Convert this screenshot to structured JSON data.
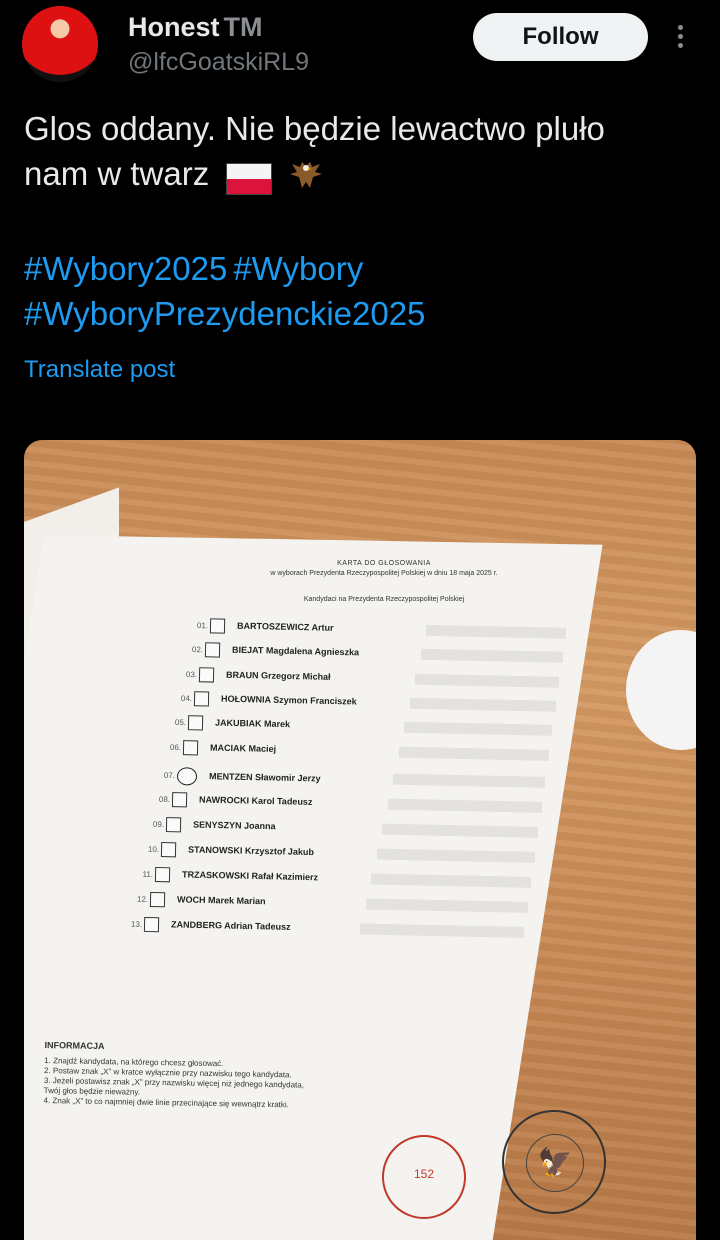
{
  "author": {
    "name": "Honest",
    "badge": "TM",
    "handle": "@lfcGoatskiRL9"
  },
  "follow_label": "Follow",
  "post": {
    "text_line1": "Glos oddany. Nie będzie lewactwo pluło",
    "text_line2": "nam w twarz",
    "hashtags": [
      "#Wybory2025",
      "#Wybory",
      "#WyboryPrezydenckie2025"
    ],
    "translate_label": "Translate post"
  },
  "ballot": {
    "title": "KARTA DO GŁOSOWANIA",
    "subtitle": "w wyborach Prezydenta Rzeczypospolitej Polskiej w dniu 18 maja 2025 r.",
    "heading": "Kandydaci na Prezydenta Rzeczypospolitej Polskiej",
    "candidates": [
      {
        "num": "01.",
        "name": "BARTOSZEWICZ Artur"
      },
      {
        "num": "02.",
        "name": "BIEJAT Magdalena Agnieszka"
      },
      {
        "num": "03.",
        "name": "BRAUN Grzegorz Michał"
      },
      {
        "num": "04.",
        "name": "HOŁOWNIA Szymon Franciszek"
      },
      {
        "num": "05.",
        "name": "JAKUBIAK Marek"
      },
      {
        "num": "06.",
        "name": "MACIAK Maciej"
      },
      {
        "num": "07.",
        "name": "MENTZEN Sławomir Jerzy"
      },
      {
        "num": "08.",
        "name": "NAWROCKI Karol Tadeusz"
      },
      {
        "num": "09.",
        "name": "SENYSZYN Joanna"
      },
      {
        "num": "10.",
        "name": "STANOWSKI Krzysztof Jakub"
      },
      {
        "num": "11.",
        "name": "TRZASKOWSKI Rafał Kazimierz"
      },
      {
        "num": "12.",
        "name": "WOCH Marek Marian"
      },
      {
        "num": "13.",
        "name": "ZANDBERG Adrian Tadeusz"
      }
    ],
    "info_heading": "INFORMACJA",
    "info_lines": [
      "1. Znajdź kandydata, na którego chcesz głosować.",
      "2. Postaw znak „X” w kratce wyłącznie przy nazwisku tego kandydata.",
      "3. Jeżeli postawisz znak „X” przy nazwisku więcej niż jednego kandydata,",
      "Twój głos będzie nieważny.",
      "4. Znak „X” to co najmniej dwie linie przecinające się wewnątrz kratki."
    ],
    "stamp_number": "152"
  }
}
